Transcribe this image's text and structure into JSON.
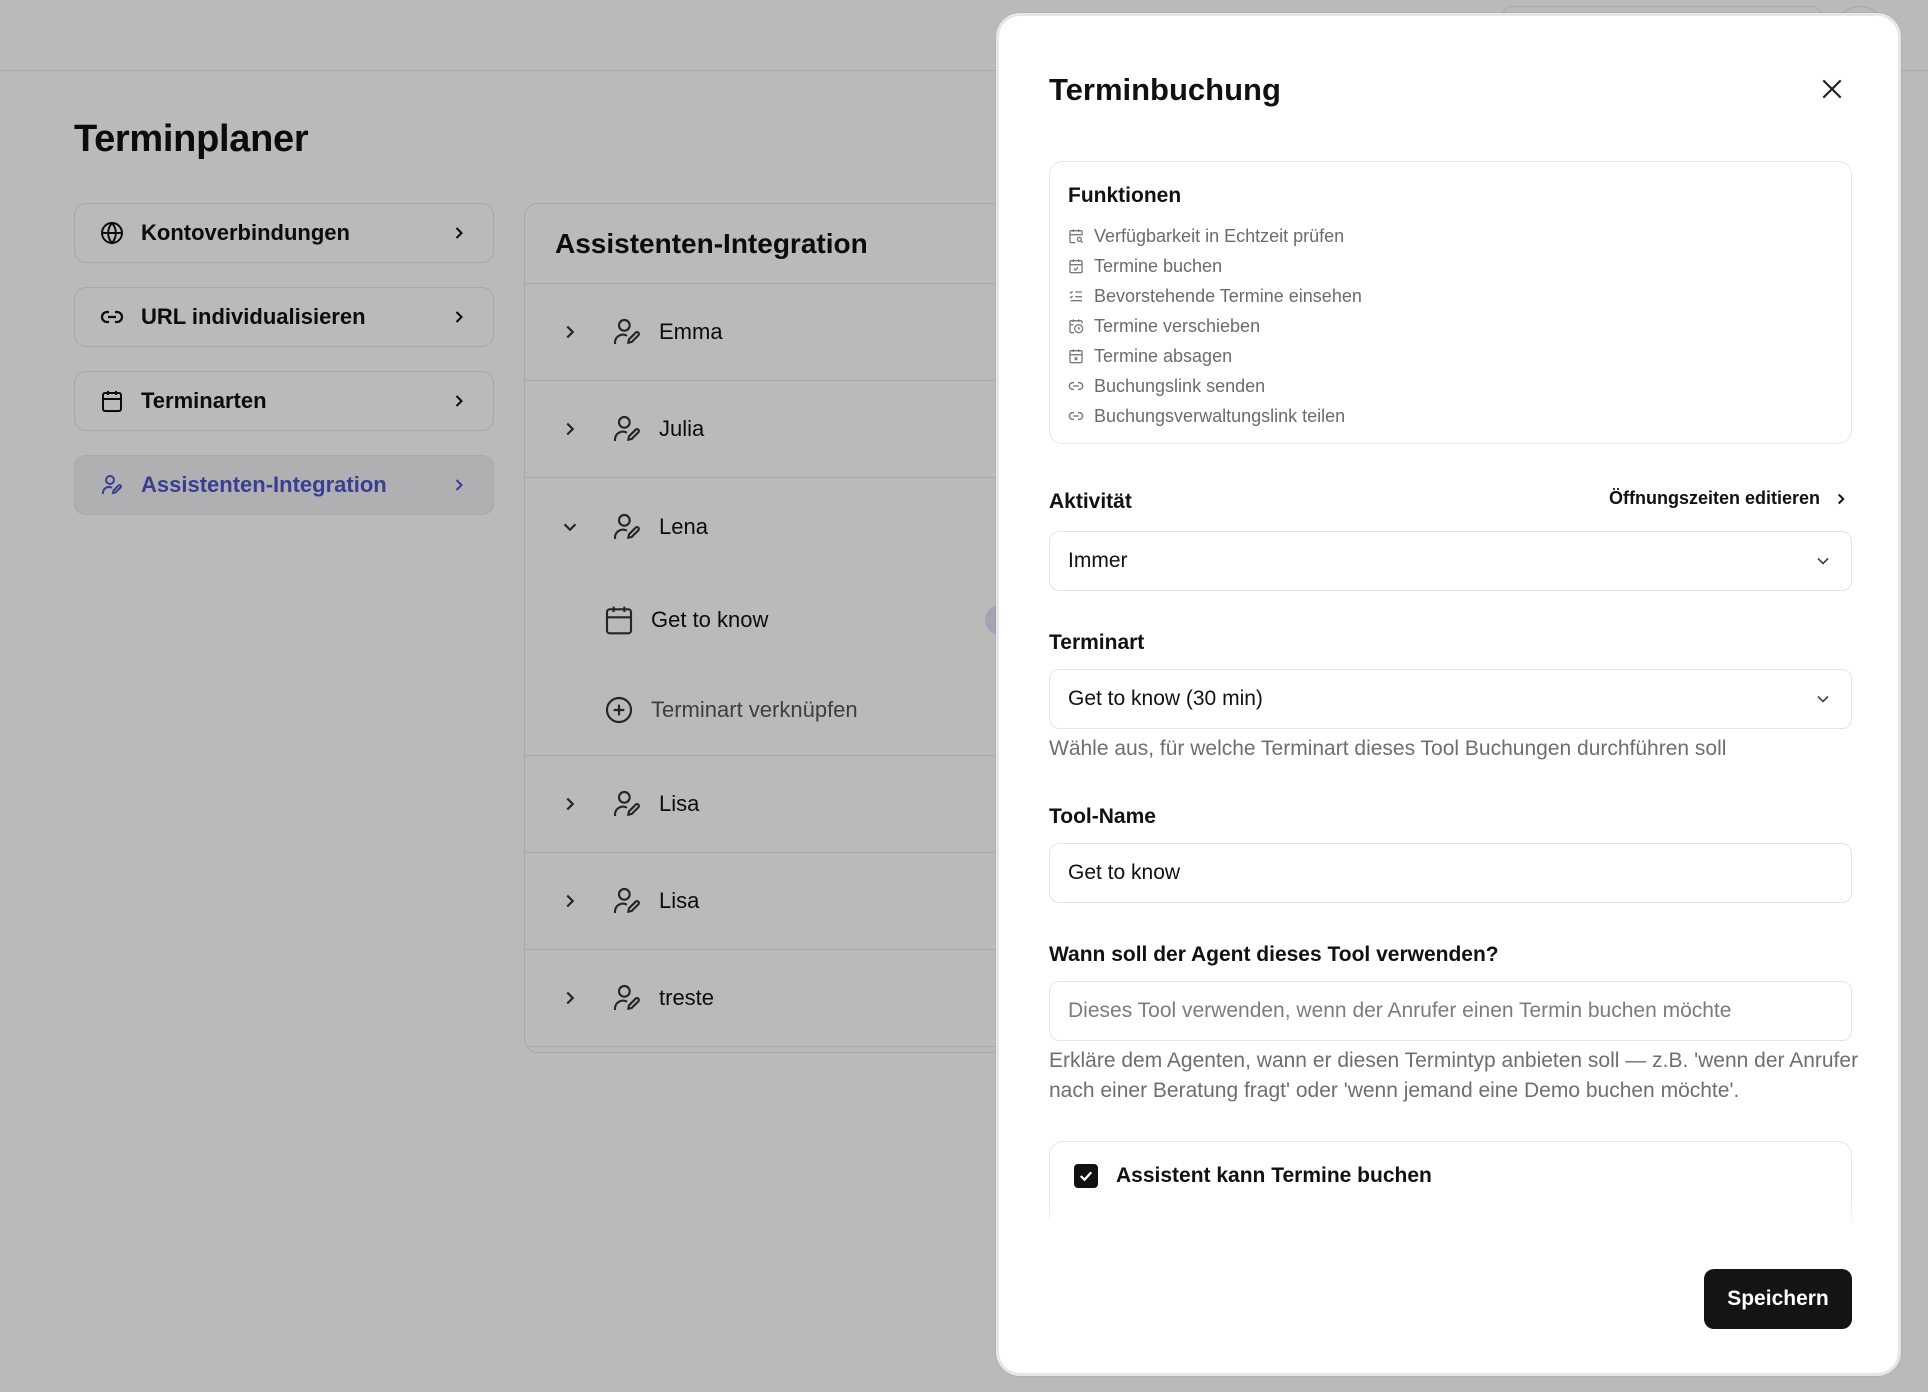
{
  "page": {
    "title": "Terminplaner",
    "nav": [
      {
        "label": "Kontoverbindungen",
        "icon": "globe-icon"
      },
      {
        "label": "URL individualisieren",
        "icon": "link-icon"
      },
      {
        "label": "Terminarten",
        "icon": "calendar-icon"
      },
      {
        "label": "Assistenten-Integration",
        "icon": "user-pen-icon",
        "active": true
      }
    ],
    "assistant_panel": {
      "title": "Assistenten-Integration",
      "agents": [
        "Emma",
        "Julia",
        "Lena",
        "Lisa",
        "Lisa",
        "treste"
      ],
      "expanded_agent": "Lena",
      "lena_items": {
        "linked_type": "Get to know",
        "link_action": "Terminart verknüpfen"
      }
    }
  },
  "drawer": {
    "title": "Terminbuchung",
    "features": {
      "heading": "Funktionen",
      "items": [
        {
          "label": "Verfügbarkeit in Echtzeit prüfen",
          "icon": "calendar-search-icon"
        },
        {
          "label": "Termine buchen",
          "icon": "calendar-check-icon"
        },
        {
          "label": "Bevorstehende Termine einsehen",
          "icon": "list-checks-icon"
        },
        {
          "label": "Termine verschieben",
          "icon": "calendar-clock-icon"
        },
        {
          "label": "Termine absagen",
          "icon": "calendar-x-icon"
        },
        {
          "label": "Buchungslink senden",
          "icon": "link-icon"
        },
        {
          "label": "Buchungsverwaltungslink teilen",
          "icon": "link-icon"
        }
      ]
    },
    "activity": {
      "label": "Aktivität",
      "edit_link": "Öffnungszeiten editieren",
      "value": "Immer"
    },
    "appointment_type": {
      "label": "Terminart",
      "value": "Get to know (30 min)",
      "help": "Wähle aus, für welche Terminart dieses Tool Buchungen durchführen soll"
    },
    "tool_name": {
      "label": "Tool-Name",
      "value": "Get to know"
    },
    "usage": {
      "label": "Wann soll der Agent dieses Tool verwenden?",
      "placeholder": "Dieses Tool verwenden, wenn der Anrufer einen Termin buchen möchte",
      "help": "Erkläre dem Agenten, wann er diesen Termintyp anbieten soll — z.B. 'wenn der Anrufer nach einer Beratung fragt' oder 'wenn jemand eine Demo buchen möchte'."
    },
    "can_book": {
      "label": "Assistent kann Termine buchen",
      "checked": true
    },
    "save_label": "Speichern"
  },
  "colors": {
    "accent": "#4f56c8",
    "primary_button": "#141414",
    "overlay": "rgba(0,0,0,0.27)"
  }
}
